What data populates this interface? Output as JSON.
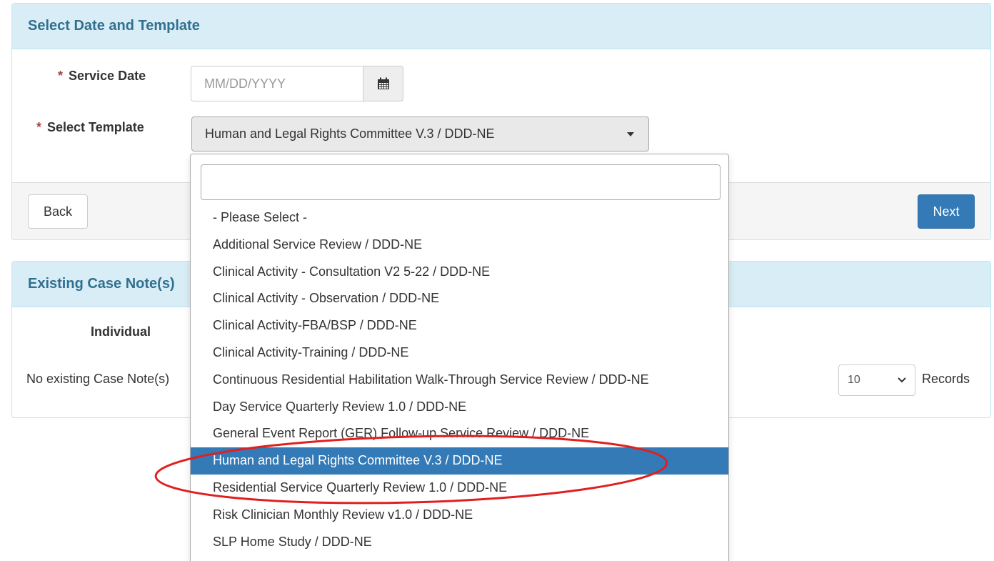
{
  "panel1": {
    "title": "Select Date and Template",
    "service_date": {
      "required_mark": "*",
      "label": "Service Date",
      "placeholder": "MM/DD/YYYY"
    },
    "template": {
      "required_mark": "*",
      "label": "Select Template",
      "selected_value": "Human and Legal Rights Committee V.3 / DDD-NE"
    },
    "back_label": "Back",
    "next_label": "Next"
  },
  "panel2": {
    "title": "Existing Case Note(s)",
    "column_header": "Individual",
    "empty_message": "No existing Case Note(s)",
    "records_value": "10",
    "records_label": "Records"
  },
  "dropdown": {
    "search_value": "",
    "options": [
      "- Please Select -",
      "Additional Service Review / DDD-NE",
      "Clinical Activity - Consultation V2 5-22 / DDD-NE",
      "Clinical Activity - Observation / DDD-NE",
      "Clinical Activity-FBA/BSP / DDD-NE",
      "Clinical Activity-Training / DDD-NE",
      "Continuous Residential Habilitation Walk-Through Service Review / DDD-NE",
      "Day Service Quarterly Review 1.0 / DDD-NE",
      "General Event Report (GER) Follow-up Service Review / DDD-NE",
      "Human and Legal Rights Committee V.3 / DDD-NE",
      "Residential Service Quarterly Review 1.0 / DDD-NE",
      "Risk Clinician Monthly Review v1.0 / DDD-NE",
      "SLP Home Study / DDD-NE"
    ],
    "selected_index": 9
  },
  "icons": {
    "calendar": "calendar-icon",
    "dropdown_caret": "caret-down-icon",
    "records_chevron": "chevron-down-icon"
  },
  "colors": {
    "heading_bg": "#d9edf7",
    "heading_text": "#31708f",
    "primary": "#337ab7",
    "annotation": "#e02020"
  }
}
